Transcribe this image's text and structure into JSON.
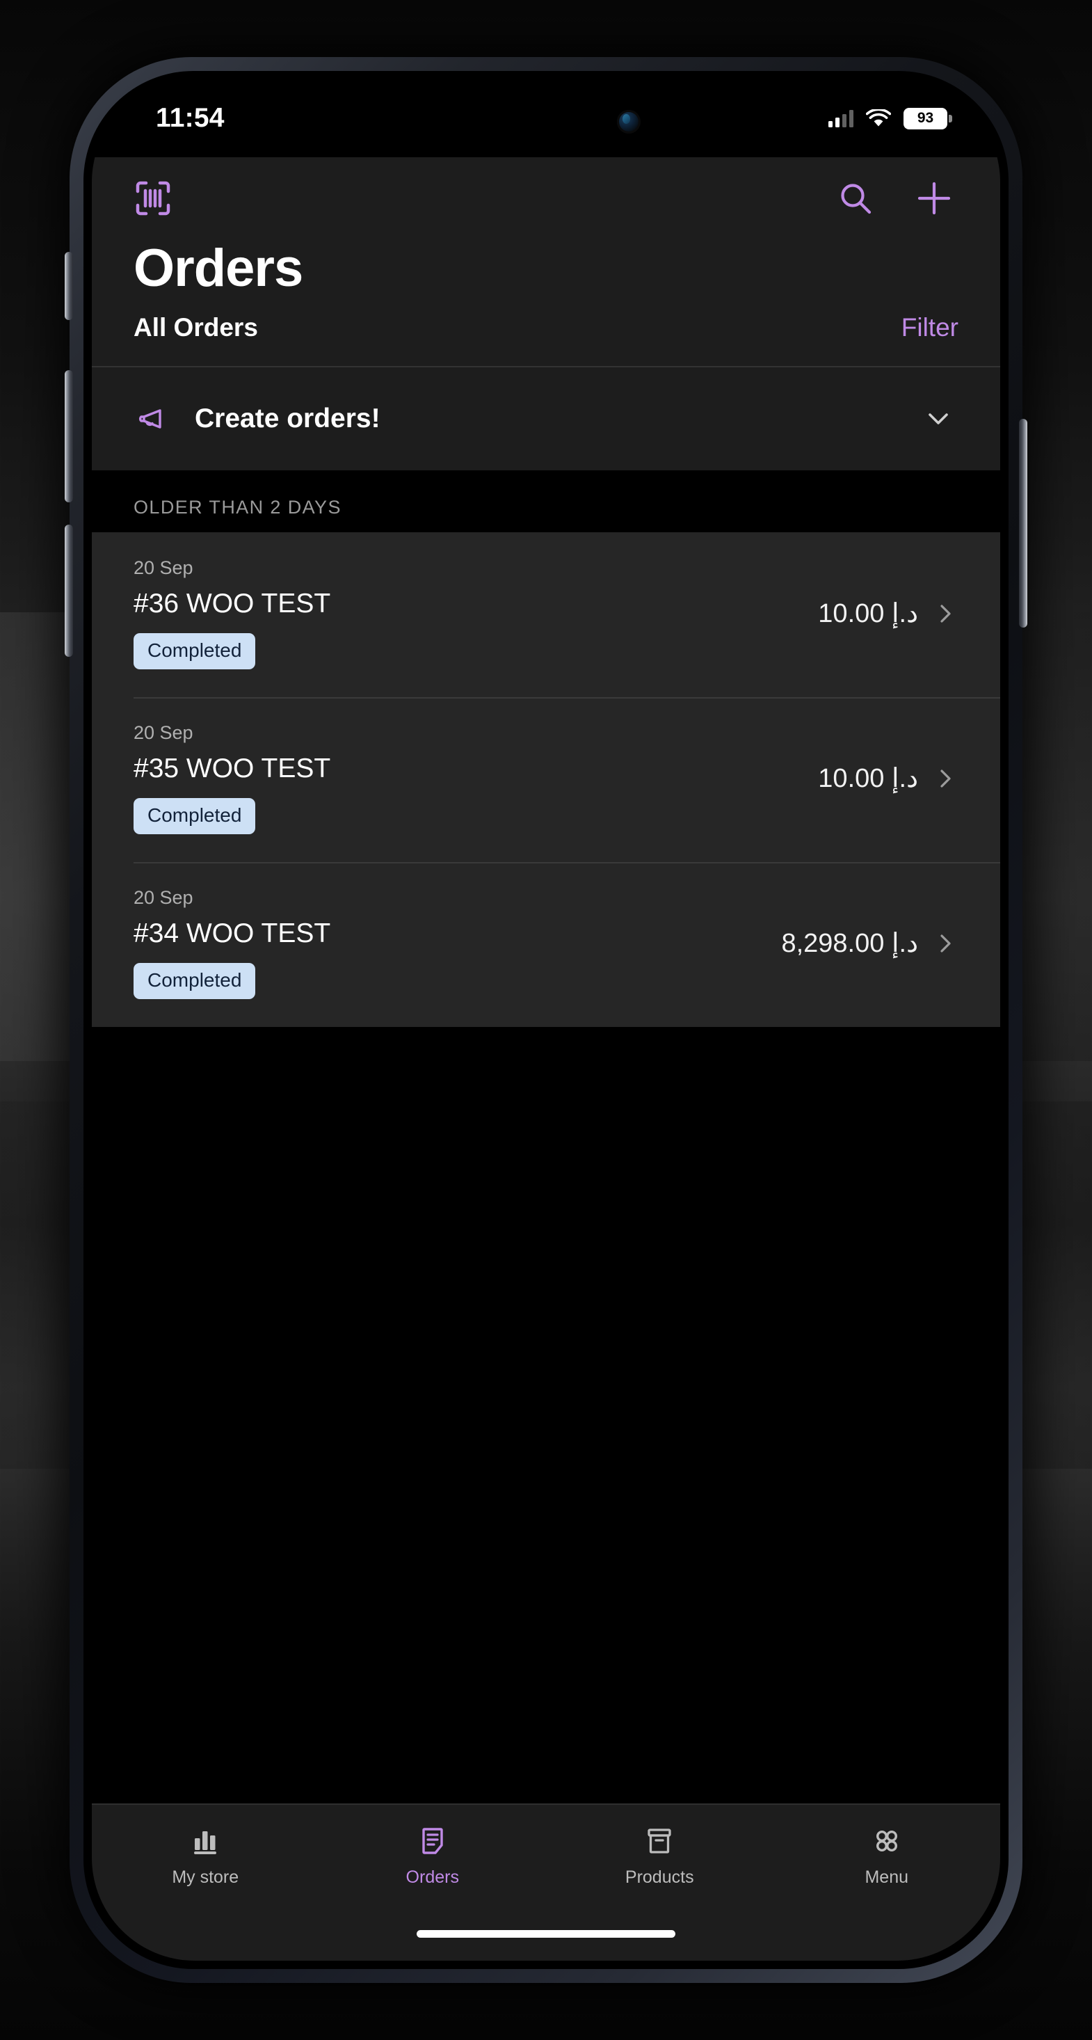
{
  "status_bar": {
    "time": "11:54",
    "battery_percent": "93",
    "cellular_icon": "cellular-bars-icon",
    "wifi_icon": "wifi-icon",
    "battery_icon": "battery-icon"
  },
  "nav": {
    "scan_icon": "barcode-scan-icon",
    "search_icon": "search-icon",
    "add_icon": "plus-icon"
  },
  "header": {
    "title": "Orders",
    "segment_label": "All Orders",
    "filter_label": "Filter"
  },
  "banner": {
    "icon": "megaphone-icon",
    "title": "Create orders!",
    "chevron_icon": "chevron-down-icon"
  },
  "list": {
    "section_header": "OLDER THAN 2 DAYS",
    "orders": [
      {
        "date": "20 Sep",
        "name": "#36 WOO TEST",
        "status": "Completed",
        "total": "10.00 د.إ",
        "chevron_icon": "chevron-right-icon"
      },
      {
        "date": "20 Sep",
        "name": "#35 WOO TEST",
        "status": "Completed",
        "total": "10.00 د.إ",
        "chevron_icon": "chevron-right-icon"
      },
      {
        "date": "20 Sep",
        "name": "#34 WOO TEST",
        "status": "Completed",
        "total": "8,298.00 د.إ",
        "chevron_icon": "chevron-right-icon"
      }
    ]
  },
  "tabbar": {
    "tabs": [
      {
        "label": "My store",
        "icon": "bar-chart-icon",
        "active": false
      },
      {
        "label": "Orders",
        "icon": "receipt-icon",
        "active": true
      },
      {
        "label": "Products",
        "icon": "archive-box-icon",
        "active": false
      },
      {
        "label": "Menu",
        "icon": "grid-circles-icon",
        "active": false
      }
    ]
  },
  "colors": {
    "accent_purple": "#c08ae6",
    "surface": "#1d1d1d",
    "card": "#262626",
    "badge_bg": "#cde0f5",
    "badge_text": "#12223a",
    "page_bg": "#000000"
  }
}
